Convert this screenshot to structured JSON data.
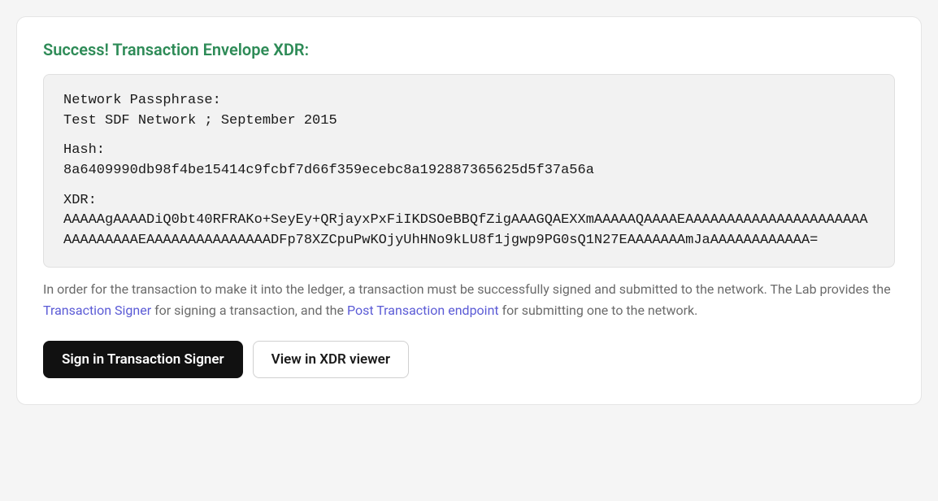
{
  "title": "Success! Transaction Envelope XDR:",
  "block": {
    "passphrase_label": "Network Passphrase:",
    "passphrase_value": "Test SDF Network ; September 2015",
    "hash_label": "Hash:",
    "hash_value": "8a6409990db98f4be15414c9fcbf7d66f359ecebc8a192887365625d5f37a56a",
    "xdr_label": "XDR:",
    "xdr_value": "AAAAAgAAAADiQ0bt40RFRAKo+SeyEy+QRjayxPxFiIKDSOeBBQfZigAAAGQAEXXmAAAAAQAAAAEAAAAAAAAAAAAAAAAAAAAAAAAAAAAAAAEAAAAAAAAAAAAAAADFp78XZCpuPwKOjyUhHNo9kLU8f1jgwp9PG0sQ1N27EAAAAAAAmJaAAAAAAAAAAAA="
  },
  "info": {
    "pre": "In order for the transaction to make it into the ledger, a transaction must be successfully signed and submitted to the network. The Lab provides the ",
    "link1": "Transaction Signer",
    "mid": " for signing a transaction, and the ",
    "link2": "Post Transaction endpoint",
    "post": " for submitting one to the network."
  },
  "buttons": {
    "sign": "Sign in Transaction Signer",
    "view": "View in XDR viewer"
  }
}
